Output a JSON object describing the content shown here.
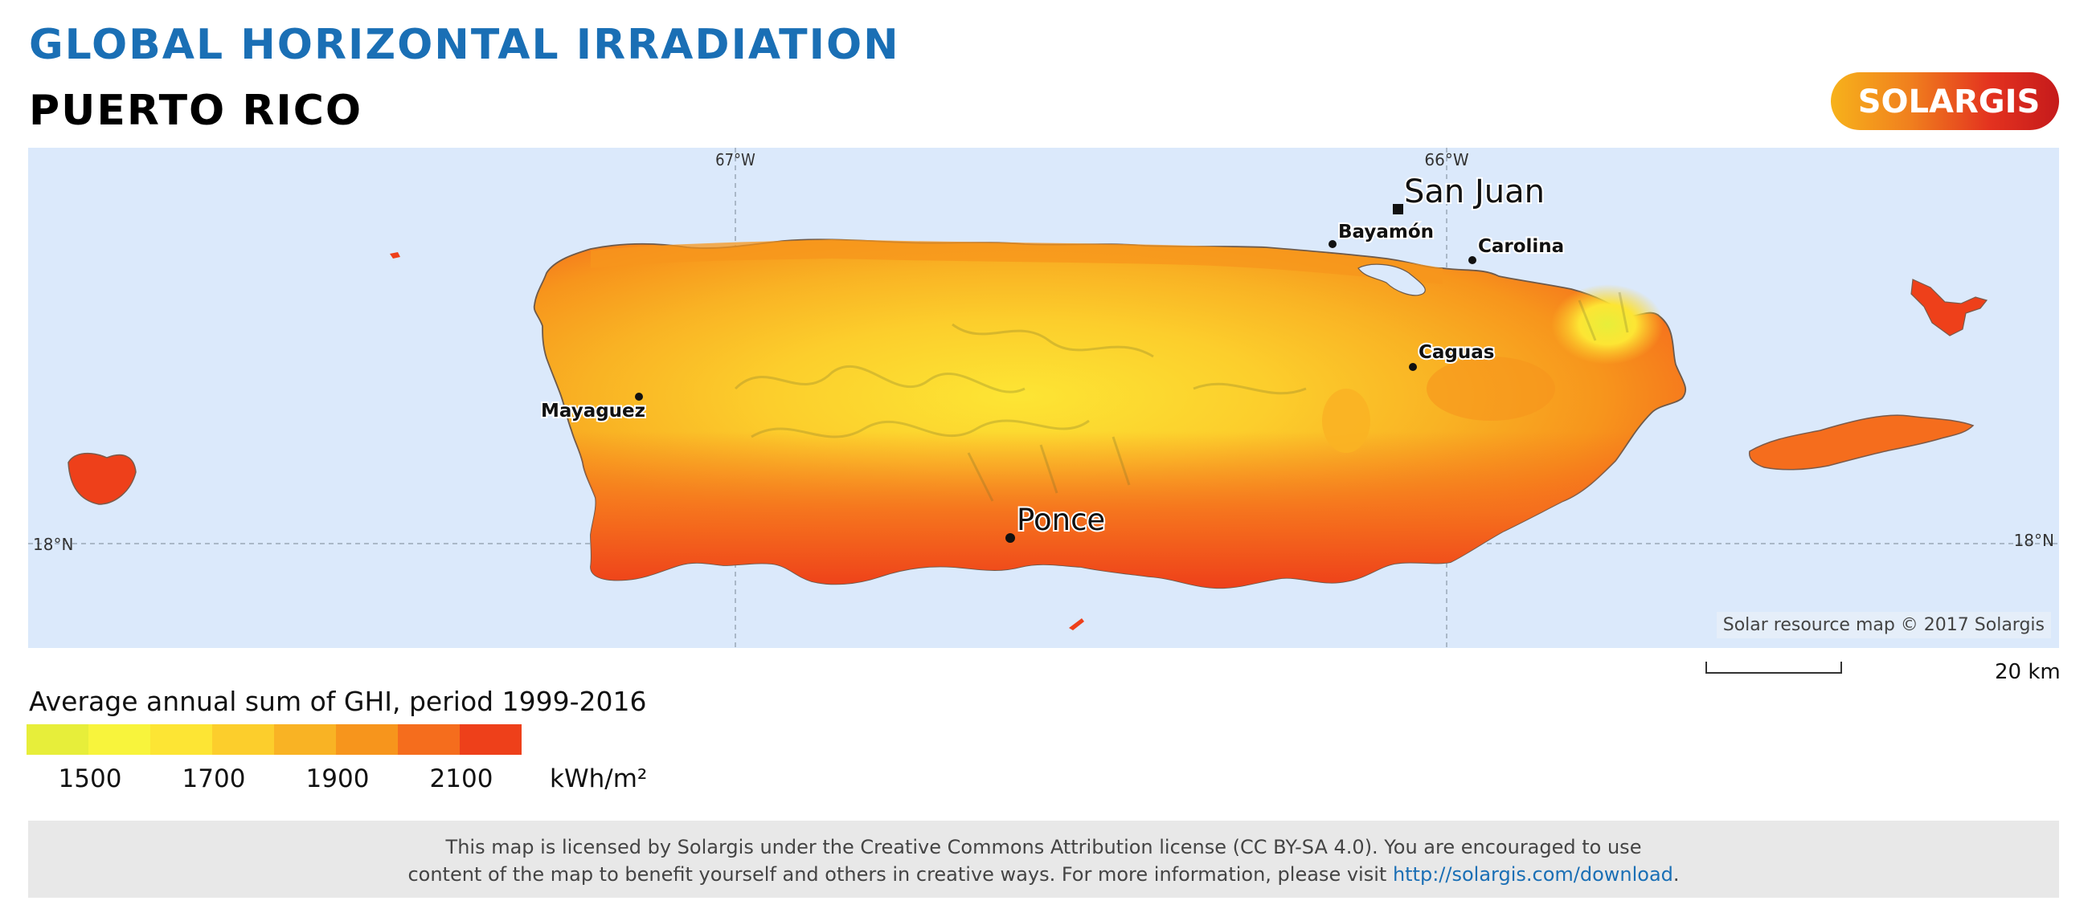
{
  "header": {
    "title": "GLOBAL HORIZONTAL IRRADIATION",
    "subtitle": "PUERTO RICO"
  },
  "logo": {
    "text": "SOLARGIS",
    "colors": [
      "#f7b21b",
      "#f07f1e",
      "#e3321f",
      "#c51a1b"
    ]
  },
  "map": {
    "ocean_color": "#dbe9fb",
    "graticule": {
      "meridians": [
        "67°W",
        "66°W"
      ],
      "parallel_left": "18°N",
      "parallel_right": "18°N"
    },
    "cities": [
      {
        "name": "San Juan",
        "marker": "square",
        "major": true
      },
      {
        "name": "Bayamón",
        "marker": "dot",
        "major": false
      },
      {
        "name": "Carolina",
        "marker": "dot",
        "major": false
      },
      {
        "name": "Caguas",
        "marker": "dot",
        "major": false
      },
      {
        "name": "Mayaguez",
        "marker": "dot",
        "major": false
      },
      {
        "name": "Ponce",
        "marker": "dot",
        "major": true
      }
    ],
    "credit": "Solar resource map © 2017 Solargis"
  },
  "scale": {
    "label": "20 km"
  },
  "legend": {
    "title": "Average annual sum of GHI, period 1999-2016",
    "colors": [
      "#e7ee3a",
      "#f8f43c",
      "#fde534",
      "#fcce2c",
      "#f9b324",
      "#f7951c",
      "#f56d1d",
      "#ee401a"
    ],
    "ticks": [
      "1500",
      "1700",
      "1900",
      "2100"
    ],
    "unit": "kWh/m²"
  },
  "footer": {
    "line1": "This map is licensed by Solargis under the Creative Commons Attribution license (CC BY-SA 4.0). You are encouraged to use",
    "line2": "content of the map to benefit yourself and others in creative ways. For more information, please visit",
    "link": "http://solargis.com/download",
    "end": "."
  }
}
